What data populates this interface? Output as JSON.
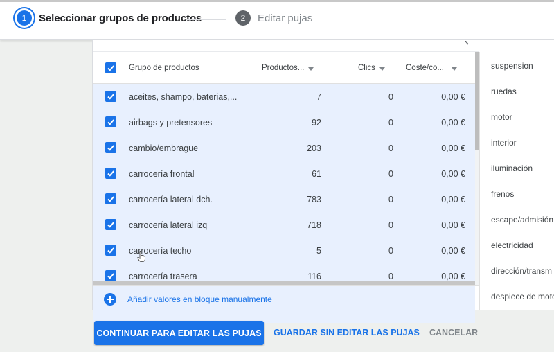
{
  "stepper": {
    "step1": {
      "number": "1",
      "label": "Seleccionar grupos de productos"
    },
    "step2": {
      "number": "2",
      "label": "Editar pujas"
    }
  },
  "table": {
    "columns": {
      "name": "Grupo de productos",
      "productos": "Productos...",
      "clics": "Clics",
      "coste": "Coste/co..."
    },
    "rows": [
      {
        "name": "aceites, shampo, baterias,...",
        "productos": "7",
        "clics": "0",
        "coste": "0,00 €"
      },
      {
        "name": "airbags y pretensores",
        "productos": "92",
        "clics": "0",
        "coste": "0,00 €"
      },
      {
        "name": "cambio/embrague",
        "productos": "203",
        "clics": "0",
        "coste": "0,00 €"
      },
      {
        "name": "carrocería frontal",
        "productos": "61",
        "clics": "0",
        "coste": "0,00 €"
      },
      {
        "name": "carrocería lateral dch.",
        "productos": "783",
        "clics": "0",
        "coste": "0,00 €"
      },
      {
        "name": "carrocería lateral izq",
        "productos": "718",
        "clics": "0",
        "coste": "0,00 €"
      },
      {
        "name": "carrocería techo",
        "productos": "5",
        "clics": "0",
        "coste": "0,00 €"
      },
      {
        "name": "carrocería trasera",
        "productos": "116",
        "clics": "0",
        "coste": "0,00 €"
      }
    ],
    "add_label": "Añadir valores en bloque manualmente"
  },
  "attributes": [
    "suspension",
    "ruedas",
    "motor",
    "interior",
    "iluminación",
    "frenos",
    "escape/admisión",
    "electricidad",
    "dirección/transm",
    "despiece de motor"
  ],
  "actions": {
    "continue_label": "CONTINUAR PARA EDITAR LAS PUJAS",
    "save_label": "GUARDAR SIN EDITAR LAS PUJAS",
    "cancel_label": "CANCELAR"
  },
  "colors": {
    "accent": "#1a73e8",
    "selected_row": "#e8f0fe"
  }
}
